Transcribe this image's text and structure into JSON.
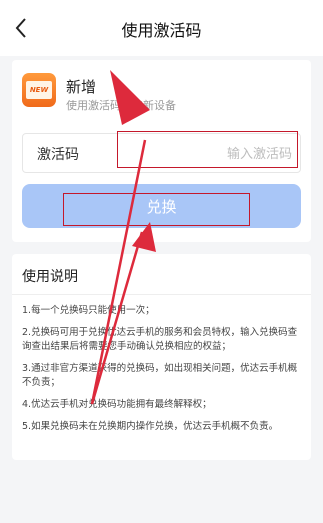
{
  "header": {
    "title": "使用激活码"
  },
  "product": {
    "logo_text": "NEW",
    "title": "新增",
    "subtitle": "使用激活码增加新设备"
  },
  "activation": {
    "label": "激活码",
    "placeholder": "输入激活码",
    "value": ""
  },
  "redeem_button": {
    "label": "兑换"
  },
  "instructions": {
    "title": "使用说明",
    "items": [
      "1.每一个兑换码只能使用一次；",
      "2.兑换码可用于兑换优达云手机的服务和会员特权，输入兑换码查询查出结果后将需要您手动确认兑换相应的权益；",
      "3.通过非官方渠道获得的兑换码，如出现相关问题，优达云手机概不负责；",
      "4.优达云手机对兑换码功能拥有最终解释权；",
      "5.如果兑换码未在兑换期内操作兑换，优达云手机概不负责。"
    ]
  },
  "colors": {
    "button_bg": "#a9c6f7",
    "highlight": "#c4182b",
    "arrow": "#dd2a3c",
    "logo": "#f06a1b"
  },
  "icons": {
    "back": "chevron-left-icon",
    "arrows": "annotation-arrow-icon"
  }
}
